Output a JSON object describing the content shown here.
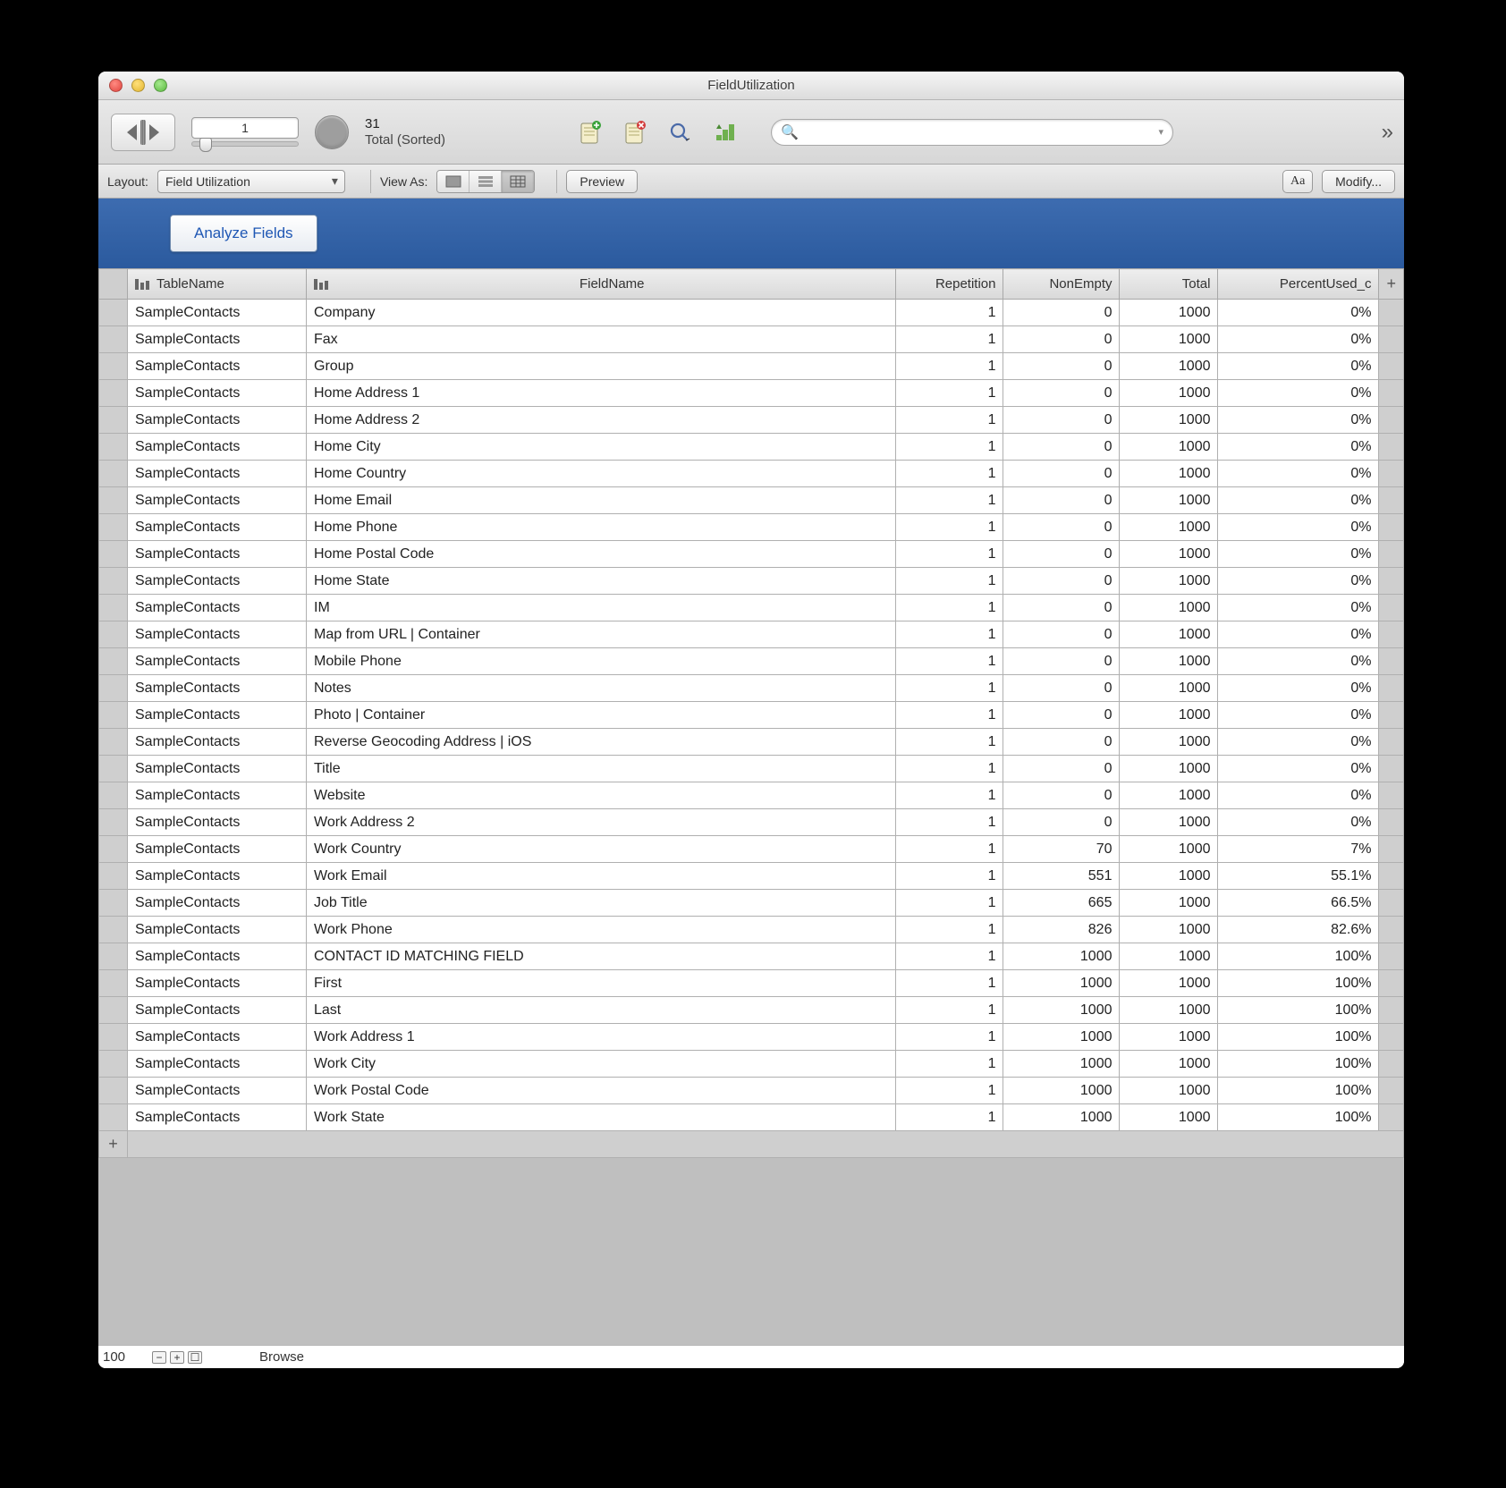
{
  "window": {
    "title": "FieldUtilization"
  },
  "toolbar": {
    "record_number": "1",
    "record_count": "31",
    "record_status": "Total (Sorted)",
    "search_placeholder": "",
    "overflow_glyph": "»"
  },
  "layoutbar": {
    "layout_label": "Layout:",
    "layout_value": "Field Utilization",
    "viewas_label": "View As:",
    "preview_label": "Preview",
    "aa_label": "Aa",
    "modify_label": "Modify..."
  },
  "blueband": {
    "analyze_label": "Analyze Fields"
  },
  "table": {
    "headers": {
      "table": "TableName",
      "field": "FieldName",
      "repetition": "Repetition",
      "nonempty": "NonEmpty",
      "total": "Total",
      "percent": "PercentUsed_c"
    },
    "rows": [
      {
        "table": "SampleContacts",
        "field": "Company",
        "rep": "1",
        "non": "0",
        "tot": "1000",
        "pct": "0%"
      },
      {
        "table": "SampleContacts",
        "field": "Fax",
        "rep": "1",
        "non": "0",
        "tot": "1000",
        "pct": "0%"
      },
      {
        "table": "SampleContacts",
        "field": "Group",
        "rep": "1",
        "non": "0",
        "tot": "1000",
        "pct": "0%"
      },
      {
        "table": "SampleContacts",
        "field": "Home Address 1",
        "rep": "1",
        "non": "0",
        "tot": "1000",
        "pct": "0%"
      },
      {
        "table": "SampleContacts",
        "field": "Home Address 2",
        "rep": "1",
        "non": "0",
        "tot": "1000",
        "pct": "0%"
      },
      {
        "table": "SampleContacts",
        "field": "Home City",
        "rep": "1",
        "non": "0",
        "tot": "1000",
        "pct": "0%"
      },
      {
        "table": "SampleContacts",
        "field": "Home Country",
        "rep": "1",
        "non": "0",
        "tot": "1000",
        "pct": "0%"
      },
      {
        "table": "SampleContacts",
        "field": "Home Email",
        "rep": "1",
        "non": "0",
        "tot": "1000",
        "pct": "0%"
      },
      {
        "table": "SampleContacts",
        "field": "Home Phone",
        "rep": "1",
        "non": "0",
        "tot": "1000",
        "pct": "0%"
      },
      {
        "table": "SampleContacts",
        "field": "Home Postal Code",
        "rep": "1",
        "non": "0",
        "tot": "1000",
        "pct": "0%"
      },
      {
        "table": "SampleContacts",
        "field": "Home State",
        "rep": "1",
        "non": "0",
        "tot": "1000",
        "pct": "0%"
      },
      {
        "table": "SampleContacts",
        "field": "IM",
        "rep": "1",
        "non": "0",
        "tot": "1000",
        "pct": "0%"
      },
      {
        "table": "SampleContacts",
        "field": "Map from URL | Container",
        "rep": "1",
        "non": "0",
        "tot": "1000",
        "pct": "0%"
      },
      {
        "table": "SampleContacts",
        "field": "Mobile Phone",
        "rep": "1",
        "non": "0",
        "tot": "1000",
        "pct": "0%"
      },
      {
        "table": "SampleContacts",
        "field": "Notes",
        "rep": "1",
        "non": "0",
        "tot": "1000",
        "pct": "0%"
      },
      {
        "table": "SampleContacts",
        "field": "Photo | Container",
        "rep": "1",
        "non": "0",
        "tot": "1000",
        "pct": "0%"
      },
      {
        "table": "SampleContacts",
        "field": "Reverse Geocoding Address | iOS",
        "rep": "1",
        "non": "0",
        "tot": "1000",
        "pct": "0%"
      },
      {
        "table": "SampleContacts",
        "field": "Title",
        "rep": "1",
        "non": "0",
        "tot": "1000",
        "pct": "0%"
      },
      {
        "table": "SampleContacts",
        "field": "Website",
        "rep": "1",
        "non": "0",
        "tot": "1000",
        "pct": "0%"
      },
      {
        "table": "SampleContacts",
        "field": "Work Address 2",
        "rep": "1",
        "non": "0",
        "tot": "1000",
        "pct": "0%"
      },
      {
        "table": "SampleContacts",
        "field": "Work Country",
        "rep": "1",
        "non": "70",
        "tot": "1000",
        "pct": "7%"
      },
      {
        "table": "SampleContacts",
        "field": "Work Email",
        "rep": "1",
        "non": "551",
        "tot": "1000",
        "pct": "55.1%"
      },
      {
        "table": "SampleContacts",
        "field": "Job Title",
        "rep": "1",
        "non": "665",
        "tot": "1000",
        "pct": "66.5%"
      },
      {
        "table": "SampleContacts",
        "field": "Work Phone",
        "rep": "1",
        "non": "826",
        "tot": "1000",
        "pct": "82.6%"
      },
      {
        "table": "SampleContacts",
        "field": "CONTACT ID MATCHING FIELD",
        "rep": "1",
        "non": "1000",
        "tot": "1000",
        "pct": "100%"
      },
      {
        "table": "SampleContacts",
        "field": "First",
        "rep": "1",
        "non": "1000",
        "tot": "1000",
        "pct": "100%"
      },
      {
        "table": "SampleContacts",
        "field": "Last",
        "rep": "1",
        "non": "1000",
        "tot": "1000",
        "pct": "100%"
      },
      {
        "table": "SampleContacts",
        "field": "Work Address 1",
        "rep": "1",
        "non": "1000",
        "tot": "1000",
        "pct": "100%"
      },
      {
        "table": "SampleContacts",
        "field": "Work City",
        "rep": "1",
        "non": "1000",
        "tot": "1000",
        "pct": "100%"
      },
      {
        "table": "SampleContacts",
        "field": "Work Postal Code",
        "rep": "1",
        "non": "1000",
        "tot": "1000",
        "pct": "100%"
      },
      {
        "table": "SampleContacts",
        "field": "Work State",
        "rep": "1",
        "non": "1000",
        "tot": "1000",
        "pct": "100%"
      }
    ]
  },
  "status": {
    "zoom": "100",
    "mode": "Browse"
  }
}
